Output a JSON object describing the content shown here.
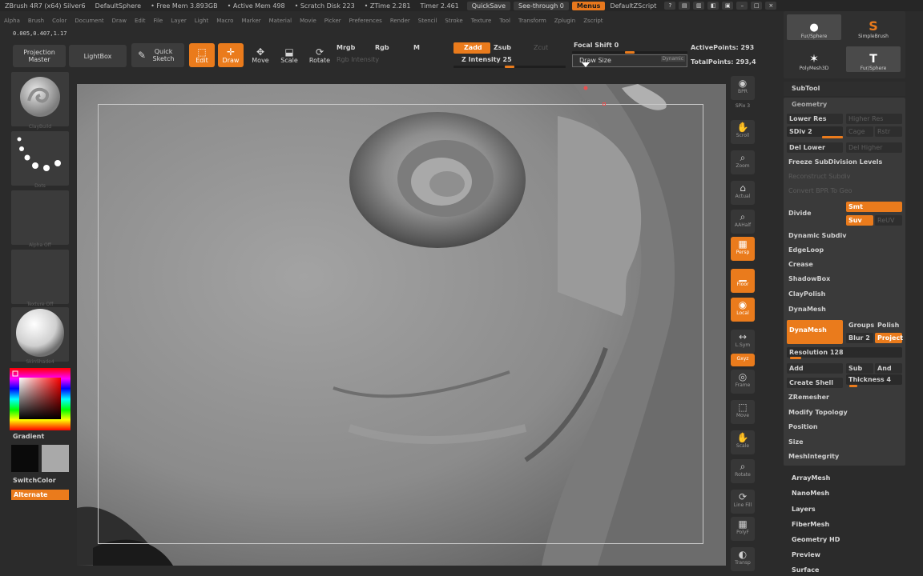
{
  "titlebar": {
    "app": "ZBrush 4R7 (x64) Silver6",
    "document": "DefaultSphere",
    "free_mem": "• Free Mem 3.893GB",
    "active_mem": "• Active Mem 498",
    "scratch": "• Scratch Disk 223",
    "ztime": "• ZTime 2.281",
    "timer": "Timer 2.461",
    "quicksave": "QuickSave",
    "seethrough": "See-through 0",
    "menus": "Menus",
    "zscript": "DefaultZScript"
  },
  "menubar": [
    "Alpha",
    "Brush",
    "Color",
    "Document",
    "Draw",
    "Edit",
    "File",
    "Layer",
    "Light",
    "Macro",
    "Marker",
    "Material",
    "Movie",
    "Picker",
    "Preferences",
    "Render",
    "Stencil",
    "Stroke",
    "Texture",
    "Tool",
    "Transform",
    "Zplugin",
    "Zscript"
  ],
  "coords": "0.005,0.407,1.17",
  "shelf": {
    "projection_master": "Projection Master",
    "lightbox": "LightBox",
    "quick_sketch": "Quick Sketch",
    "edit": "Edit",
    "draw": "Draw",
    "move": "Move",
    "scale": "Scale",
    "rotate": "Rotate",
    "mrgb": "Mrgb",
    "rgb": "Rgb",
    "m": "M",
    "rgb_intensity": "Rgb Intensity",
    "zadd": "Zadd",
    "zsub": "Zsub",
    "zcut": "Zcut",
    "z_intensity": "Z Intensity 25",
    "focal_shift": "Focal Shift 0",
    "draw_size": "Draw Size",
    "dynamic": "Dynamic",
    "active_points": "ActivePoints: 293",
    "total_points": "TotalPoints: 293,4"
  },
  "left": {
    "brush_caption": "ClayBuild",
    "stroke_caption": "Dots",
    "alpha_caption": "Alpha Off",
    "texture_caption": "Texture Off",
    "material_caption": "SkinShade4",
    "gradient": "Gradient",
    "switchcolor": "SwitchColor",
    "alternate": "Alternate",
    "colors": {
      "accent": "#ea7b1c",
      "main_color": "#0a0a0a",
      "secondary_color": "#a9a9a9"
    }
  },
  "nav": [
    "BPR",
    "SPix 3",
    "Scroll",
    "Zoom",
    "Actual",
    "AAHalf",
    "Persp",
    "Floor",
    "Local",
    "L.Sym",
    "Gxyz",
    "Frame",
    "Move",
    "Scale",
    "Rotate",
    "Line Fill",
    "PolyF",
    "Transp"
  ],
  "right": {
    "tiles": [
      "Fur/Sphere",
      "SimpleBrush",
      "PolyMesh3D",
      "Fur/Sphere"
    ],
    "subtool": "SubTool",
    "geometry": "Geometry",
    "lower_res": "Lower Res",
    "higher_res": "Higher Res",
    "sdiv": "SDiv 2",
    "cage": "Cage",
    "rstr": "Rstr",
    "del_lower": "Del Lower",
    "del_higher": "Del Higher",
    "freeze": "Freeze SubDivision Levels",
    "reconstruct": "Reconstruct Subdiv",
    "convert_bpr": "Convert BPR To Geo",
    "divide": "Divide",
    "smt": "Smt",
    "suv": "Suv",
    "reuv": "ReUV",
    "dynamic_subdiv": "Dynamic Subdiv",
    "edgeloop": "EdgeLoop",
    "crease": "Crease",
    "shadowbox": "ShadowBox",
    "claypolish": "ClayPolish",
    "dynamesh_header": "DynaMesh",
    "dynamesh_btn": "DynaMesh",
    "groups": "Groups",
    "polish": "Polish",
    "blur": "Blur 2",
    "project": "Project",
    "resolution": "Resolution 128",
    "add": "Add",
    "sub": "Sub",
    "and": "And",
    "create_shell": "Create Shell",
    "thickness": "Thickness 4",
    "zremesher": "ZRemesher",
    "modify_topology": "Modify Topology",
    "position": "Position",
    "size": "Size",
    "meshintegrity": "MeshIntegrity",
    "arraymesh": "ArrayMesh",
    "nanomesh": "NanoMesh",
    "layers": "Layers",
    "fibermesh": "FiberMesh",
    "geometry_hd": "Geometry HD",
    "preview": "Preview",
    "surface": "Surface"
  }
}
